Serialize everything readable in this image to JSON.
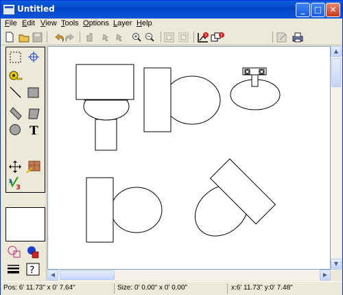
{
  "window": {
    "title": "Untitled",
    "buttons": {
      "minimize": "_",
      "maximize": "□",
      "close": "✕"
    }
  },
  "menu": [
    "File",
    "Edit",
    "View",
    "Tools",
    "Options",
    "Layer",
    "Help"
  ],
  "toolbar": {
    "icons": [
      "new-file-icon",
      "open-folder-icon",
      "save-icon",
      "undo-icon",
      "redo-icon",
      "pan-icon",
      "pick-icon",
      "pick2-icon",
      "zoom-in-icon",
      "zoom-out-icon",
      "fit-icon",
      "fit-selection-icon",
      "chart-question-icon",
      "shapes-question-icon",
      "note-icon",
      "print-icon"
    ]
  },
  "palette": {
    "tools": [
      "selection-rect-icon",
      "crosshair-icon",
      "tape-measure-icon",
      "line-icon",
      "rectangle-icon",
      "wall-icon",
      "polygon-icon",
      "circle-icon",
      "text-icon",
      "move-icon",
      "paint-icon",
      "symbol-icon"
    ],
    "text_label": "T",
    "help_label": "?"
  },
  "status": {
    "pos": "Pos: 6' 11.73\" x 0' 7.64\"",
    "size": "Size: 0' 0.00\" x 0' 0.00\"",
    "xy": "x:6' 11.73\" y:0' 7.48\""
  },
  "colors": {
    "title_blue": "#0a5fdc",
    "chrome": "#ece9d8",
    "canvas": "#ffffff"
  }
}
